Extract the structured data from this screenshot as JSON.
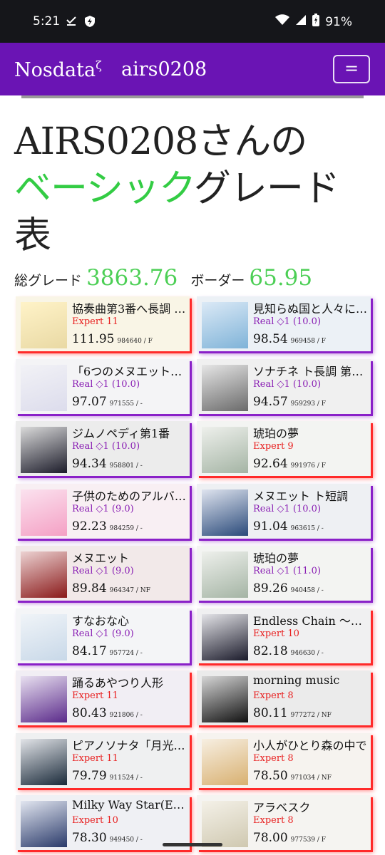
{
  "status": {
    "time": "5:21",
    "battery": "91%"
  },
  "header": {
    "brand": "Nosdata",
    "brand_mark": "ζ",
    "user": "airs0208",
    "menu_label": "="
  },
  "page": {
    "title_prefix": "AIRS0208さんの",
    "title_green": "ベーシック",
    "title_rest": "グレード",
    "title_last": "表",
    "total_label": "総グレード",
    "total_value": "3863.76",
    "border_label": "ボーダー",
    "border_value": "65.95"
  },
  "cards": [
    {
      "name": "協奏曲第3番へ長調 …",
      "diff": "Expert 11",
      "type": "expert",
      "rate": "111.95",
      "score": "984640 / F",
      "color": "#e9d9a4",
      "bg": "#fff3c8"
    },
    {
      "name": "見知らぬ国と人々に…",
      "diff": "Real ◇1 (10.0)",
      "type": "real",
      "rate": "98.54",
      "score": "969458 / F",
      "color": "#7fb3d8",
      "bg": "#dbe9f6"
    },
    {
      "name": "「6つのメヌエット…",
      "diff": "Real ◇1 (10.0)",
      "type": "real",
      "rate": "97.07",
      "score": "971555 / -",
      "color": "#dcdcec",
      "bg": "#f2f2f6"
    },
    {
      "name": "ソナチネ ト長調 第1…",
      "diff": "Real ◇1 (10.0)",
      "type": "real",
      "rate": "94.57",
      "score": "959293 / F",
      "color": "#6a6a6a",
      "bg": "#e6e6e6"
    },
    {
      "name": "ジムノペディ第1番",
      "diff": "Real ◇1 (10.0)",
      "type": "real",
      "rate": "94.34",
      "score": "958801 / -",
      "color": "#1c1c2a",
      "bg": "#dadada"
    },
    {
      "name": "琥珀の夢",
      "diff": "Expert 9",
      "type": "expert",
      "rate": "92.64",
      "score": "991976 / F",
      "color": "#a4b4a4",
      "bg": "#eef0ec"
    },
    {
      "name": "子供のためのアルバ…",
      "diff": "Real ◇1 (9.0)",
      "type": "real",
      "rate": "92.23",
      "score": "984259 / -",
      "color": "#f4a0c4",
      "bg": "#fbe2ef"
    },
    {
      "name": "メヌエット ト短調",
      "diff": "Real ◇1 (10.0)",
      "type": "real",
      "rate": "91.04",
      "score": "963615 / -",
      "color": "#2a4a7a",
      "bg": "#dfe4ef"
    },
    {
      "name": "メヌエット",
      "diff": "Real ◇1 (9.0)",
      "type": "real",
      "rate": "89.84",
      "score": "964347 / NF",
      "color": "#8a1a1a",
      "bg": "#ecd2d2"
    },
    {
      "name": "琥珀の夢",
      "diff": "Real ◇1 (11.0)",
      "type": "real",
      "rate": "89.26",
      "score": "940458 / -",
      "color": "#a4b4a4",
      "bg": "#eef0ec"
    },
    {
      "name": "すなおな心",
      "diff": "Real ◇1 (9.0)",
      "type": "real",
      "rate": "84.17",
      "score": "957724 / -",
      "color": "#c8d8e8",
      "bg": "#f0f4f8"
    },
    {
      "name": "Endless Chain 〜2…",
      "diff": "Expert 10",
      "type": "expert",
      "rate": "82.18",
      "score": "946630 / -",
      "color": "#1a1a2a",
      "bg": "#e4e4e8"
    },
    {
      "name": "踊るあやつり人形",
      "diff": "Expert 11",
      "type": "expert",
      "rate": "80.43",
      "score": "921806 / -",
      "color": "#5a2a8a",
      "bg": "#e8e0f0"
    },
    {
      "name": "morning music",
      "diff": "Expert 8",
      "type": "expert",
      "rate": "80.11",
      "score": "977272 / NF",
      "color": "#111111",
      "bg": "#d6d6d6"
    },
    {
      "name": "ピアノソナタ「月光…",
      "diff": "Expert 11",
      "type": "expert",
      "rate": "79.79",
      "score": "911524 / -",
      "color": "#1a2a3a",
      "bg": "#e2e4e8"
    },
    {
      "name": "小人がひとり森の中で",
      "diff": "Expert 8",
      "type": "expert",
      "rate": "78.50",
      "score": "971034 / NF",
      "color": "#d8b070",
      "bg": "#f7efe2"
    },
    {
      "name": "Milky Way Star(Ex…",
      "diff": "Expert 10",
      "type": "expert",
      "rate": "78.30",
      "score": "949450 / -",
      "color": "#2a3a6a",
      "bg": "#e2e6f0"
    },
    {
      "name": "アラベスク",
      "diff": "Expert 8",
      "type": "expert",
      "rate": "78.00",
      "score": "977539 / F",
      "color": "#cfc8b0",
      "bg": "#f4f1e8"
    }
  ]
}
